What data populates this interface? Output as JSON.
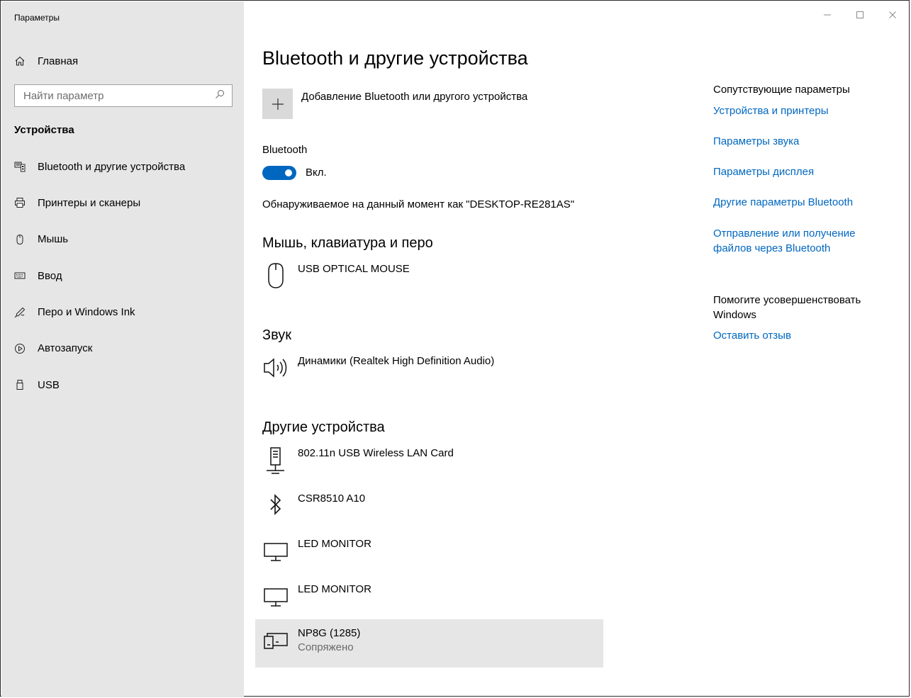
{
  "window": {
    "title": "Параметры",
    "buttons": [
      "minimize",
      "maximize",
      "close"
    ]
  },
  "sidebar": {
    "home_label": "Главная",
    "search_placeholder": "Найти параметр",
    "section_label": "Устройства",
    "items": [
      {
        "label": "Bluetooth и другие устройства",
        "icon": "bluetooth-devices-icon"
      },
      {
        "label": "Принтеры и сканеры",
        "icon": "printer-icon"
      },
      {
        "label": "Мышь",
        "icon": "mouse-icon"
      },
      {
        "label": "Ввод",
        "icon": "keyboard-icon"
      },
      {
        "label": "Перо и Windows Ink",
        "icon": "pen-icon"
      },
      {
        "label": "Автозапуск",
        "icon": "autoplay-icon"
      },
      {
        "label": "USB",
        "icon": "usb-icon"
      }
    ]
  },
  "main": {
    "title": "Bluetooth и другие устройства",
    "add_device_label": "Добавление Bluetooth или другого устройства",
    "bluetooth_label": "Bluetooth",
    "bluetooth_state": "Вкл.",
    "bluetooth_on": true,
    "discoverable_text": "Обнаруживаемое на данный момент как \"DESKTOP-RE281AS\"",
    "groups": {
      "input": {
        "title": "Мышь, клавиатура и перо",
        "devices": [
          {
            "name": "USB OPTICAL MOUSE",
            "icon": "mouse-icon"
          }
        ]
      },
      "audio": {
        "title": "Звук",
        "devices": [
          {
            "name": "Динамики (Realtek High Definition Audio)",
            "icon": "speaker-icon"
          }
        ]
      },
      "other": {
        "title": "Другие устройства",
        "devices": [
          {
            "name": "802.11n USB Wireless LAN Card",
            "icon": "network-adapter-icon"
          },
          {
            "name": "CSR8510 A10",
            "icon": "bluetooth-icon"
          },
          {
            "name": "LED MONITOR",
            "icon": "monitor-icon"
          },
          {
            "name": "LED MONITOR",
            "icon": "monitor-icon"
          },
          {
            "name": "NP8G (1285)",
            "status": "Сопряжено",
            "icon": "device-icon"
          }
        ]
      }
    }
  },
  "related": {
    "title": "Сопутствующие параметры",
    "links": [
      "Устройства и принтеры",
      "Параметры звука",
      "Параметры дисплея",
      "Другие параметры Bluetooth",
      "Отправление или получение файлов через Bluetooth"
    ]
  },
  "feedback": {
    "title": "Помогите усовершенствовать Windows",
    "link": "Оставить отзыв"
  },
  "colors": {
    "accent": "#0067c0",
    "sidebar_bg": "#e6e6e6",
    "selected_bg": "#e6e6e6"
  }
}
